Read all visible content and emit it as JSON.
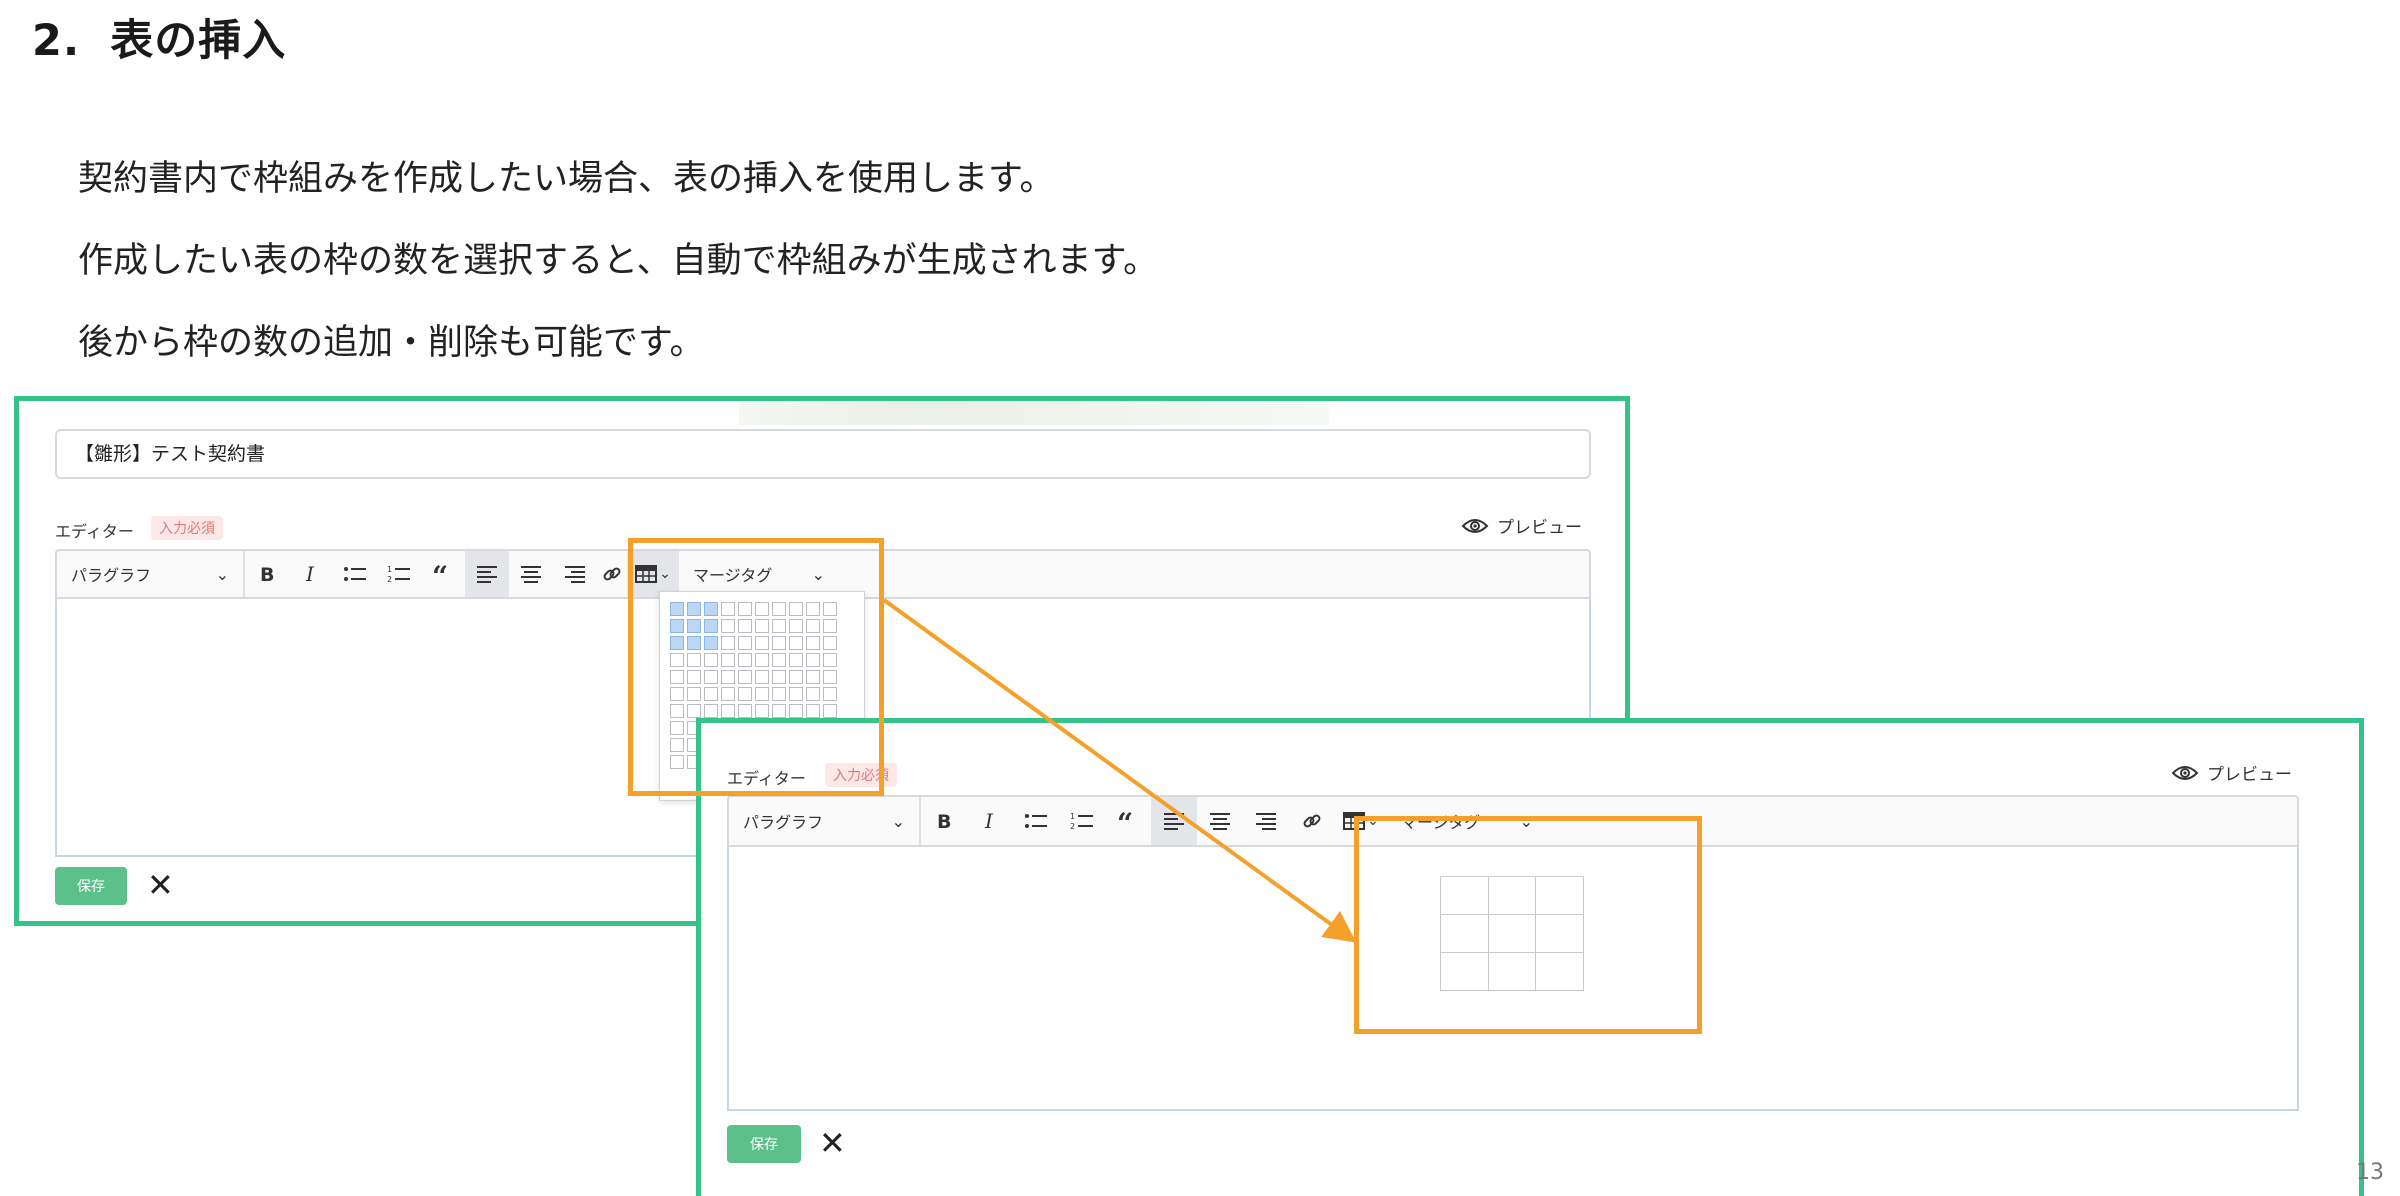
{
  "heading": {
    "number": "2.",
    "title": "表の挿入"
  },
  "paragraphs": [
    "契約書内で枠組みを作成したい場合、表の挿入を使用します。",
    "作成したい表の枠の数を選択すると、自動で枠組みが生成されます。",
    "後から枠の数の追加・削除も可能です。"
  ],
  "screen1": {
    "title_value": "【雛形】テスト契約書",
    "editor_label": "エディター",
    "required_badge": "入力必須",
    "preview_label": "プレビュー",
    "paragraph_select": "パラグラフ",
    "merge_tag_select": "マージタグ",
    "save_label": "保存",
    "table_picker": {
      "rows": 10,
      "cols": 10,
      "selected_rows": 3,
      "selected_cols": 3
    }
  },
  "screen2": {
    "editor_label": "エディター",
    "required_badge": "入力必須",
    "preview_label": "プレビュー",
    "paragraph_select": "パラグラフ",
    "merge_tag_select": "マージタグ",
    "save_label": "保存",
    "inserted_table": {
      "rows": 3,
      "cols": 3
    }
  },
  "page_number": "13",
  "colors": {
    "frame": "#35c38a",
    "highlight": "#f4a12b",
    "save_button": "#5cc08a",
    "grid_selected": "#bcd7f3"
  }
}
